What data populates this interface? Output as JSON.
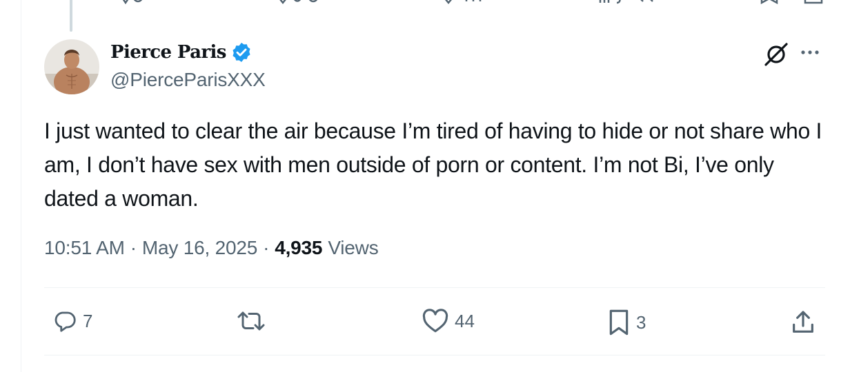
{
  "author": {
    "display_name": "Pierce Paris",
    "handle": "@PierceParisXXX",
    "verified": true,
    "verified_color": "#1d9bf0"
  },
  "tweet": {
    "text": "I just wanted to clear the air because I’m tired of having to hide or not share who I am, I don’t have sex with men outside of porn or content. I’m not Bi, I’ve only dated a woman.",
    "time": "10:51 AM",
    "date": "May 16, 2025",
    "separator": "·",
    "views_count": "4,935",
    "views_label": "Views"
  },
  "actions": {
    "reply_count": "7",
    "retweet_count": "",
    "like_count": "44",
    "bookmark_count": "3"
  },
  "icons": [
    "grok-icon",
    "more-icon",
    "verified-badge-icon",
    "reply-icon",
    "retweet-icon",
    "like-icon",
    "bookmark-icon",
    "share-icon"
  ],
  "colors": {
    "text_primary": "#0f1419",
    "text_secondary": "#536471",
    "divider": "#eff3f4",
    "accent": "#1d9bf0"
  }
}
